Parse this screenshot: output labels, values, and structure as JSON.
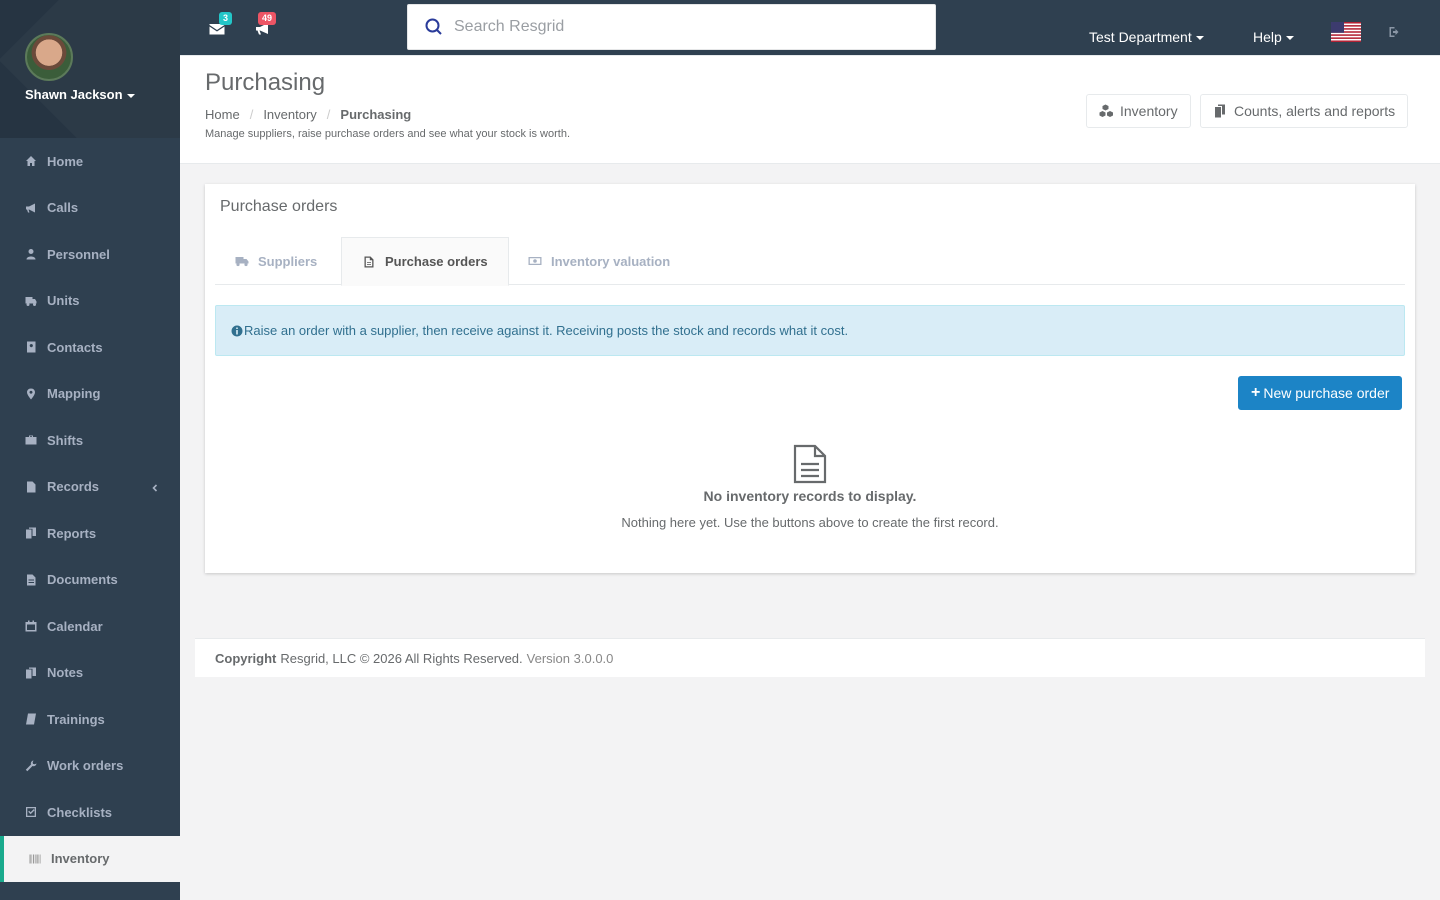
{
  "user": {
    "name": "Shawn Jackson"
  },
  "sidebar": {
    "items": [
      {
        "label": "Home",
        "icon": "home-icon"
      },
      {
        "label": "Calls",
        "icon": "bullhorn-icon"
      },
      {
        "label": "Personnel",
        "icon": "user-icon"
      },
      {
        "label": "Units",
        "icon": "truck-icon"
      },
      {
        "label": "Contacts",
        "icon": "address-book-icon"
      },
      {
        "label": "Mapping",
        "icon": "map-marker-icon"
      },
      {
        "label": "Shifts",
        "icon": "briefcase-icon"
      },
      {
        "label": "Records",
        "icon": "file-icon"
      },
      {
        "label": "Reports",
        "icon": "copy-icon"
      },
      {
        "label": "Documents",
        "icon": "file-text-icon"
      },
      {
        "label": "Calendar",
        "icon": "calendar-icon"
      },
      {
        "label": "Notes",
        "icon": "notes-icon"
      },
      {
        "label": "Trainings",
        "icon": "book-icon"
      },
      {
        "label": "Work orders",
        "icon": "wrench-icon"
      },
      {
        "label": "Checklists",
        "icon": "check-square-icon"
      },
      {
        "label": "Inventory",
        "icon": "barcode-icon"
      }
    ]
  },
  "topbar": {
    "messages_count": "3",
    "calls_count": "49",
    "search_placeholder": "Search Resgrid",
    "department": "Test Department",
    "help": "Help"
  },
  "heading": {
    "title": "Purchasing",
    "breadcrumb": [
      "Home",
      "Inventory",
      "Purchasing"
    ],
    "subtitle": "Manage suppliers, raise purchase orders and see what your stock is worth.",
    "inventory_button": "Inventory",
    "reports_button": "Counts, alerts and reports"
  },
  "content": {
    "title": "Purchase orders",
    "tabs": [
      "Suppliers",
      "Purchase orders",
      "Inventory valuation"
    ],
    "alert": "Raise an order with a supplier, then receive against it. Receiving posts the stock and records what it cost.",
    "new_button": "New purchase order",
    "empty_title": "No inventory records to display.",
    "empty_sub": "Nothing here yet. Use the buttons above to create the first record."
  },
  "footer": {
    "copyright": "Copyright",
    "text": "Resgrid, LLC © 2026 All Rights Reserved.",
    "version": "Version 3.0.0.0"
  },
  "colors": {
    "sidebar_bg": "#2f4050",
    "primary": "#1c84c6",
    "alert_bg": "#d9edf7",
    "messages_badge": "#23c6c8",
    "calls_badge": "#ed5565"
  }
}
